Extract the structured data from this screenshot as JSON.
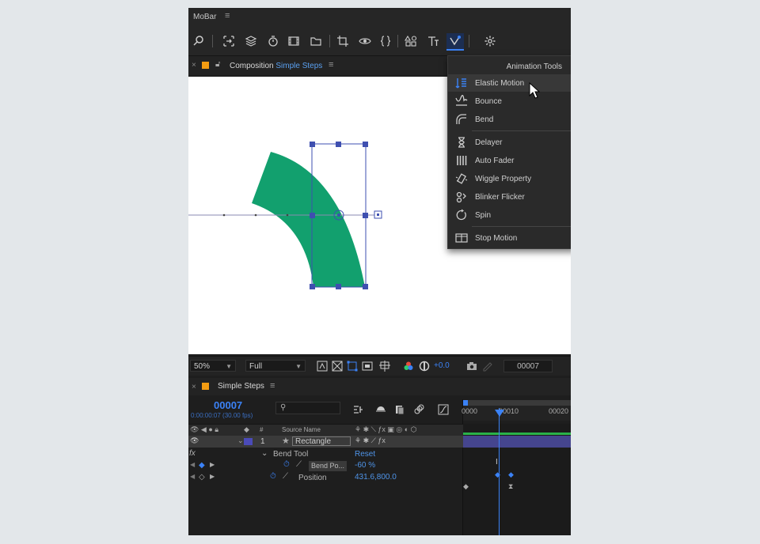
{
  "app": {
    "title": "MoBar",
    "menu_glyph": "≡"
  },
  "composition_tab": {
    "close": "×",
    "label": "Composition",
    "name": "Simple Steps",
    "menu_glyph": "≡"
  },
  "animation_tools": {
    "header": "Animation Tools",
    "items": [
      {
        "label": "Elastic Motion",
        "icon": "elastic-motion-icon",
        "highlighted": true
      },
      {
        "label": "Bounce",
        "icon": "bounce-icon"
      },
      {
        "label": "Bend",
        "icon": "bend-icon"
      },
      {
        "label": "Delayer",
        "icon": "hourglass-icon"
      },
      {
        "label": "Auto Fader",
        "icon": "auto-fader-icon"
      },
      {
        "label": "Wiggle Property",
        "icon": "wiggle-icon"
      },
      {
        "label": "Blinker Flicker",
        "icon": "blinker-icon"
      },
      {
        "label": "Spin",
        "icon": "spin-icon"
      },
      {
        "label": "Stop Motion",
        "icon": "stop-motion-icon"
      }
    ]
  },
  "viewer_bar": {
    "zoom": "50%",
    "resolution": "Full",
    "exposure": "+0.0",
    "current_frame": "00007"
  },
  "timeline": {
    "close": "×",
    "tab_name": "Simple Steps",
    "menu_glyph": "≡",
    "timecode": "00007",
    "timecode_sub": "0:00:00:07 (30.00 fps)",
    "ruler": [
      "0000",
      "00010",
      "00020"
    ],
    "columns": {
      "source_name": "Source Name",
      "hash": "#"
    },
    "layer": {
      "number": "1",
      "name": "Rectangle"
    },
    "effect": {
      "fx": "fx",
      "name": "Bend Tool",
      "reset": "Reset"
    },
    "bend_prop": {
      "name": "Bend Po...",
      "value": "-60 %"
    },
    "position": {
      "name": "Position",
      "value": "431.6,800.0"
    }
  },
  "colors": {
    "shape_fill": "#12a06e",
    "accent": "#3b82f6",
    "selection": "#3e4fb0",
    "label_swatch": "#f39c12"
  }
}
